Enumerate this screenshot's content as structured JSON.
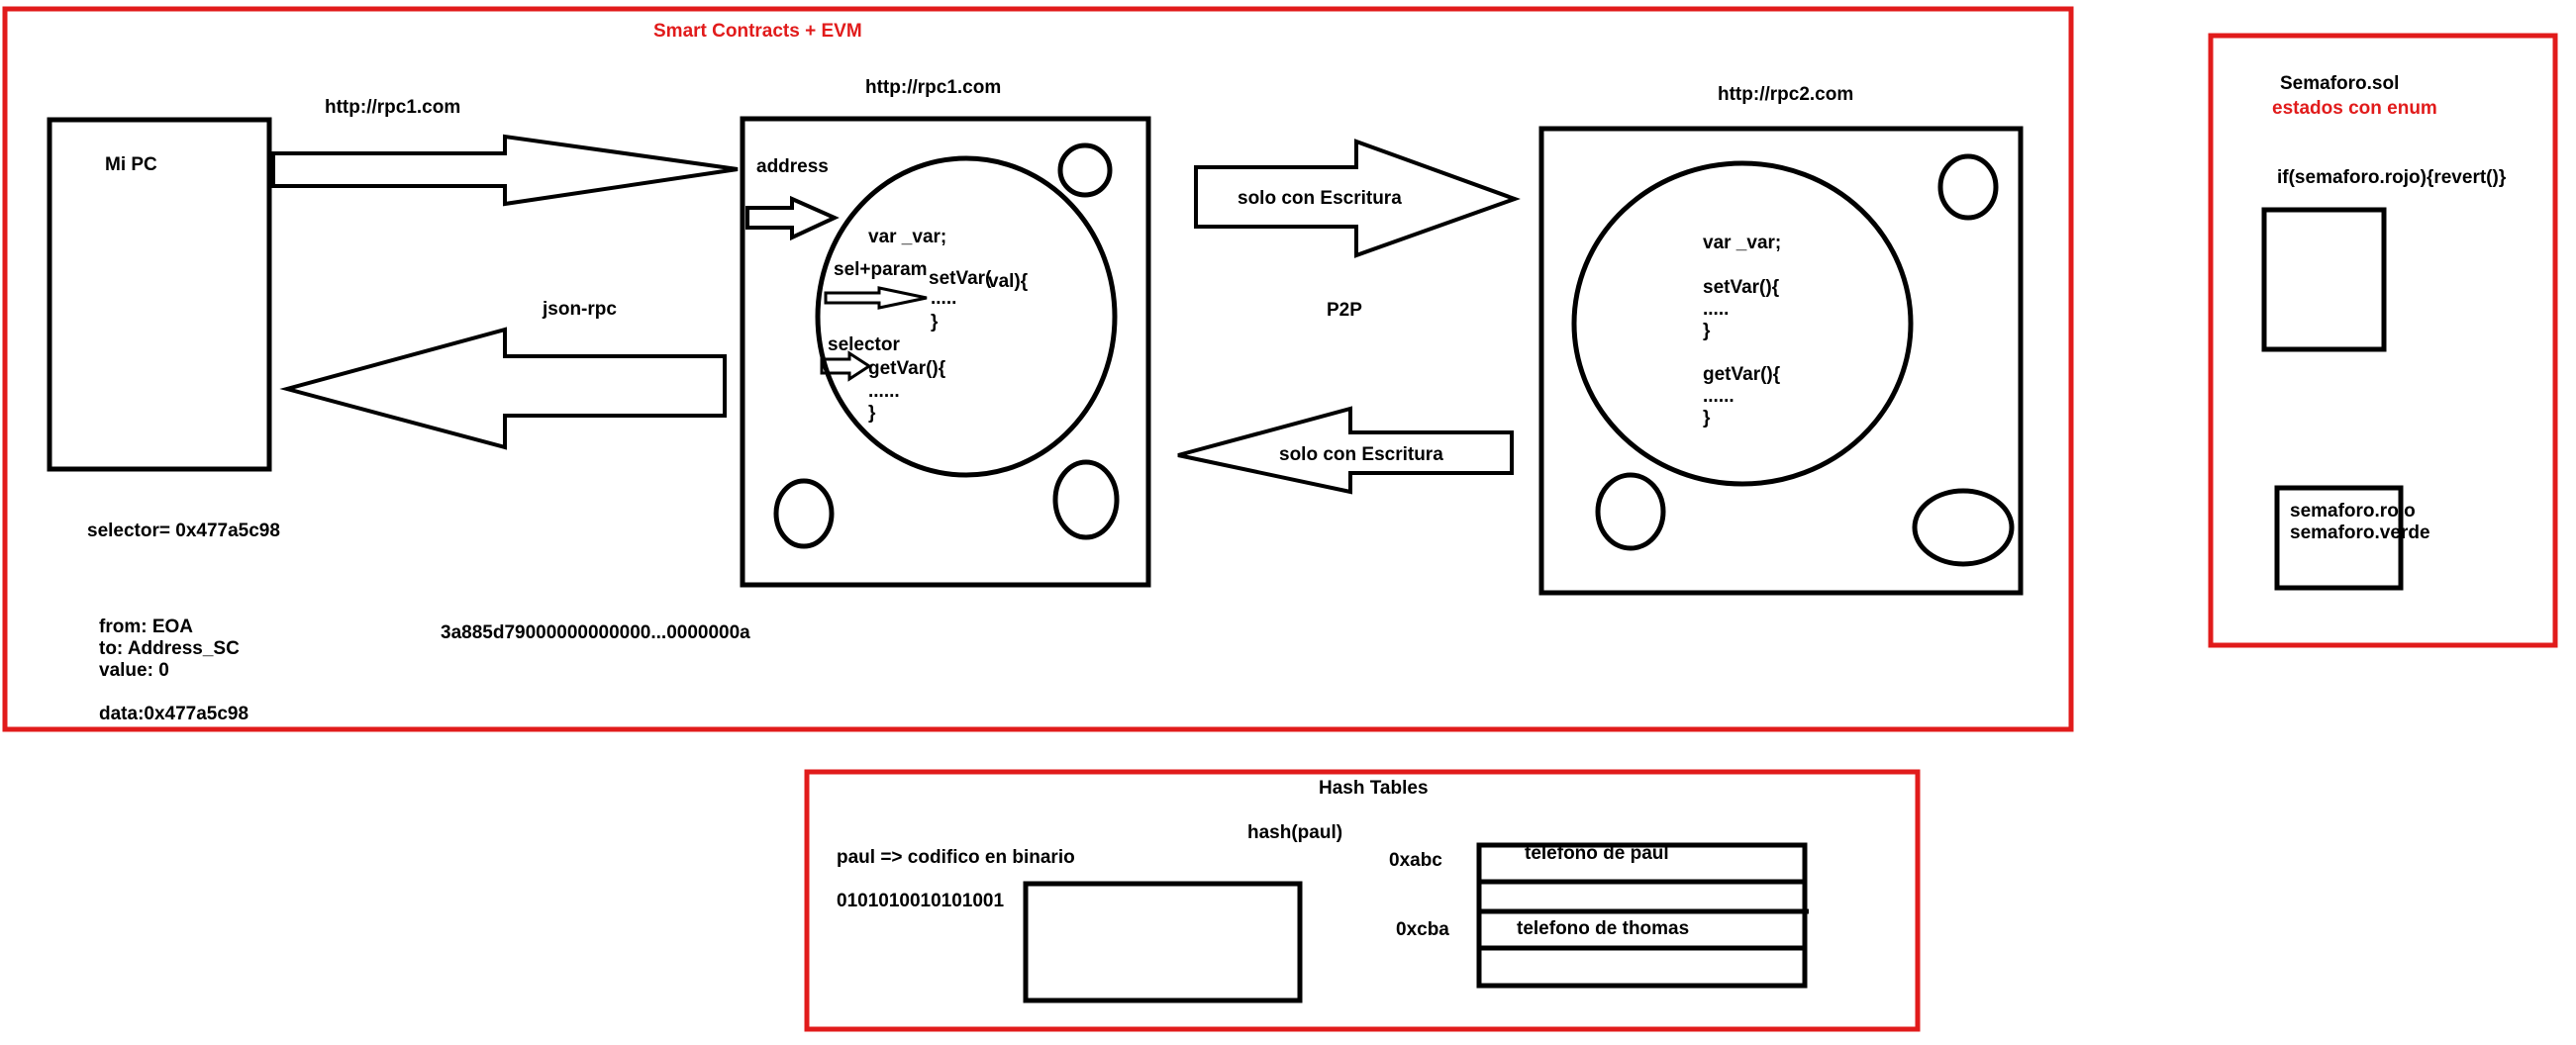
{
  "colors": {
    "frame_red": "#e11b1b",
    "ink": "#000000",
    "background": "#ffffff"
  },
  "smart_contracts": {
    "title": "Smart Contracts + EVM",
    "mi_pc": "Mi PC",
    "rpc1_label_left": "http://rpc1.com",
    "json_rpc": "json-rpc",
    "selector_value": "selector= 0x477a5c98",
    "tx": {
      "from": "from: EOA",
      "to": "to: Address_SC",
      "value": "value: 0",
      "data": "data:0x477a5c98"
    },
    "calldata": "3a885d79000000000000...0000000a",
    "node1": {
      "url": "http://rpc1.com",
      "address": "address",
      "var_decl": "var _var;",
      "sel_param": "sel+param",
      "setvar": "setVar(",
      "val": "val){",
      "dots1": ".....",
      "close1": "}",
      "selector": "selector",
      "getvar": "getVar(){",
      "dots2": "......",
      "close2": "}"
    },
    "p2p": "P2P",
    "solo_escritura_top": "solo con Escritura",
    "solo_escritura_bottom": "solo con Escritura",
    "node2": {
      "url": "http://rpc2.com",
      "var_decl": "var _var;",
      "setvar": "setVar(){",
      "dots1": ".....",
      "close1": "}",
      "getvar": "getVar(){",
      "dots2": "......",
      "close2": "}"
    }
  },
  "semaforo": {
    "title": "Semaforo.sol",
    "subtitle": "estados con enum",
    "code": "if(semaforo.rojo){revert()}",
    "state_rojo": "semaforo.rojo",
    "state_verde": "semaforo.verde"
  },
  "hash_tables": {
    "title": "Hash Tables",
    "hash_fn": "hash(paul)",
    "encode": "paul => codifico en binario",
    "binary": "0101010010101001",
    "rows": [
      {
        "key": "0xabc",
        "value": "telefono de paul"
      },
      {
        "key": "0xcba",
        "value": "telefono de thomas"
      }
    ]
  }
}
